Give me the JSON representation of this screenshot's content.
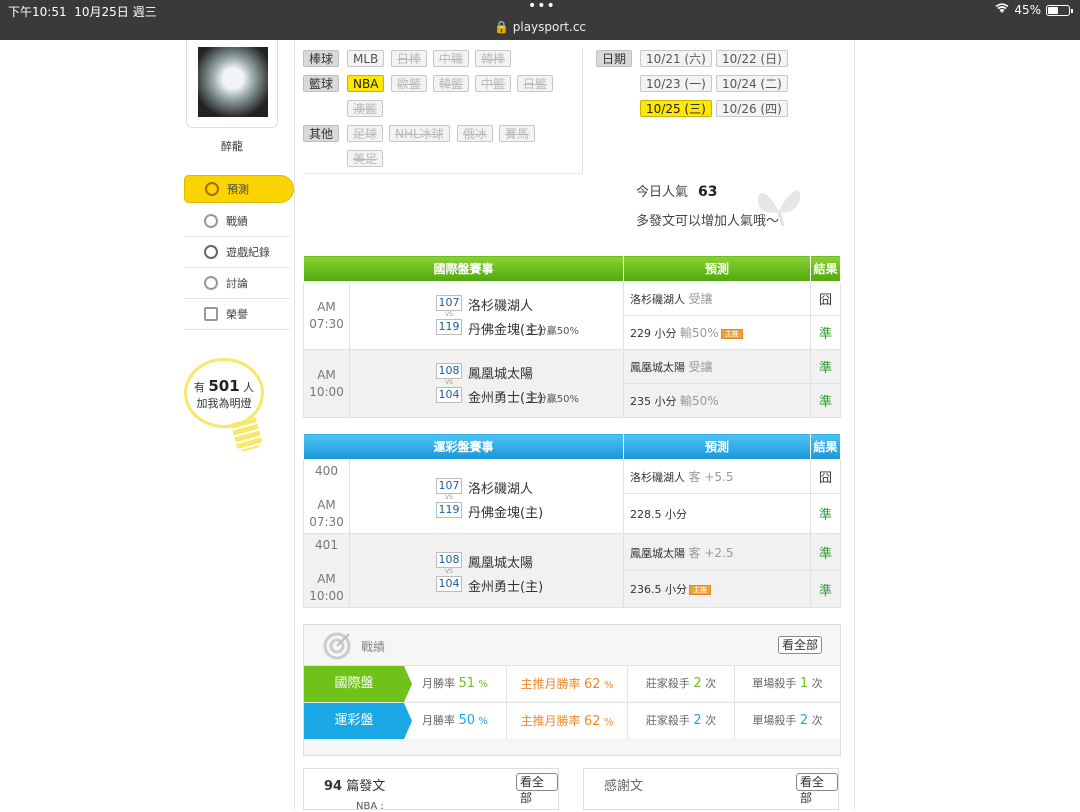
{
  "status": {
    "time": "下午10:51",
    "date": "10月25日 週三",
    "battery": "45%",
    "url": "playsport.cc",
    "dots": "•••"
  },
  "user": {
    "name": "醉龍"
  },
  "nav": {
    "items": [
      {
        "label": "預測",
        "icon": "target-icon"
      },
      {
        "label": "戰績",
        "icon": "chart-icon"
      },
      {
        "label": "遊戲紀錄",
        "icon": "record-icon"
      },
      {
        "label": "討論",
        "icon": "discuss-icon"
      },
      {
        "label": "榮譽",
        "icon": "medal-icon"
      }
    ]
  },
  "fans": {
    "prefix": "有",
    "count": "501",
    "suffix": "人",
    "line2": "加我為明燈"
  },
  "filters": {
    "baseball": {
      "label": "棒球",
      "items": [
        "MLB",
        "日棒",
        "中職",
        "韓棒"
      ]
    },
    "basketball": {
      "label": "籃球",
      "items": [
        "NBA",
        "歐籃",
        "韓籃",
        "中籃",
        "日籃",
        "澳籃"
      ]
    },
    "other": {
      "label": "其他",
      "items": [
        "足球",
        "NHL冰球",
        "俄冰",
        "賽馬",
        "美足"
      ]
    },
    "date": {
      "label": "日期",
      "items": [
        "10/21 (六)",
        "10/22 (日)",
        "10/23 (一)",
        "10/24 (二)",
        "10/25 (三)",
        "10/26 (四)"
      ]
    }
  },
  "popularity": {
    "label": "今日人氣",
    "value": "63",
    "hint": "多發文可以增加人氣哦～"
  },
  "intl": {
    "headers": [
      "國際盤賽事",
      "預測",
      "結果"
    ],
    "games": [
      {
        "ampm": "AM",
        "time": "07:30",
        "away_score": "107",
        "home_score": "119",
        "away": "洛杉磯湖人",
        "home": "丹佛金塊(主)",
        "odds": "5 分贏50%",
        "pred1_team": "洛杉磯湖人",
        "pred1_pick": "受讓",
        "res1": "囧",
        "pred2_total": "229 小分",
        "pred2_pick": "輸50%",
        "pred2_flag": "主推",
        "res2": "準"
      },
      {
        "ampm": "AM",
        "time": "10:00",
        "away_score": "108",
        "home_score": "104",
        "away": "鳳凰城太陽",
        "home": "金州勇士(主)",
        "odds": "3 分贏50%",
        "pred1_team": "鳳凰城太陽",
        "pred1_pick": "受讓",
        "res1": "準",
        "pred2_total": "235 小分",
        "pred2_pick": "輸50%",
        "res2": "準"
      }
    ]
  },
  "lottery": {
    "headers": [
      "運彩盤賽事",
      "預測",
      "結果"
    ],
    "games": [
      {
        "no": "400",
        "ampm": "AM",
        "time": "07:30",
        "away_score": "107",
        "home_score": "119",
        "away": "洛杉磯湖人",
        "home": "丹佛金塊(主)",
        "pred1_team": "洛杉磯湖人",
        "pred1_pick": "客 +5.5",
        "res1": "囧",
        "pred2_total": "228.5 小分",
        "res2": "準"
      },
      {
        "no": "401",
        "ampm": "AM",
        "time": "10:00",
        "away_score": "108",
        "home_score": "104",
        "away": "鳳凰城太陽",
        "home": "金州勇士(主)",
        "pred1_team": "鳳凰城太陽",
        "pred1_pick": "客 +2.5",
        "res1": "準",
        "pred2_total": "236.5 小分",
        "pred2_flag": "主推",
        "res2": "準"
      }
    ]
  },
  "record": {
    "title": "戰績",
    "view_all": "看全部",
    "rows": [
      {
        "label": "國際盤",
        "monthly_label": "月勝率",
        "monthly": "51",
        "main_label": "主推月勝率",
        "main": "62",
        "banker_label": "莊家殺手",
        "banker": "2",
        "single_label": "單場殺手",
        "single": "1",
        "unit": "次",
        "pct": "%"
      },
      {
        "label": "運彩盤",
        "monthly_label": "月勝率",
        "monthly": "50",
        "main_label": "主推月勝率",
        "main": "62",
        "banker_label": "莊家殺手",
        "banker": "2",
        "single_label": "單場殺手",
        "single": "2",
        "unit": "次",
        "pct": "%"
      }
    ]
  },
  "posts": {
    "count": "94",
    "label": "篇發文",
    "view_all": "看全部",
    "first": "NBA :"
  },
  "thanks": {
    "label": "感謝文",
    "view_all": "看全部"
  }
}
